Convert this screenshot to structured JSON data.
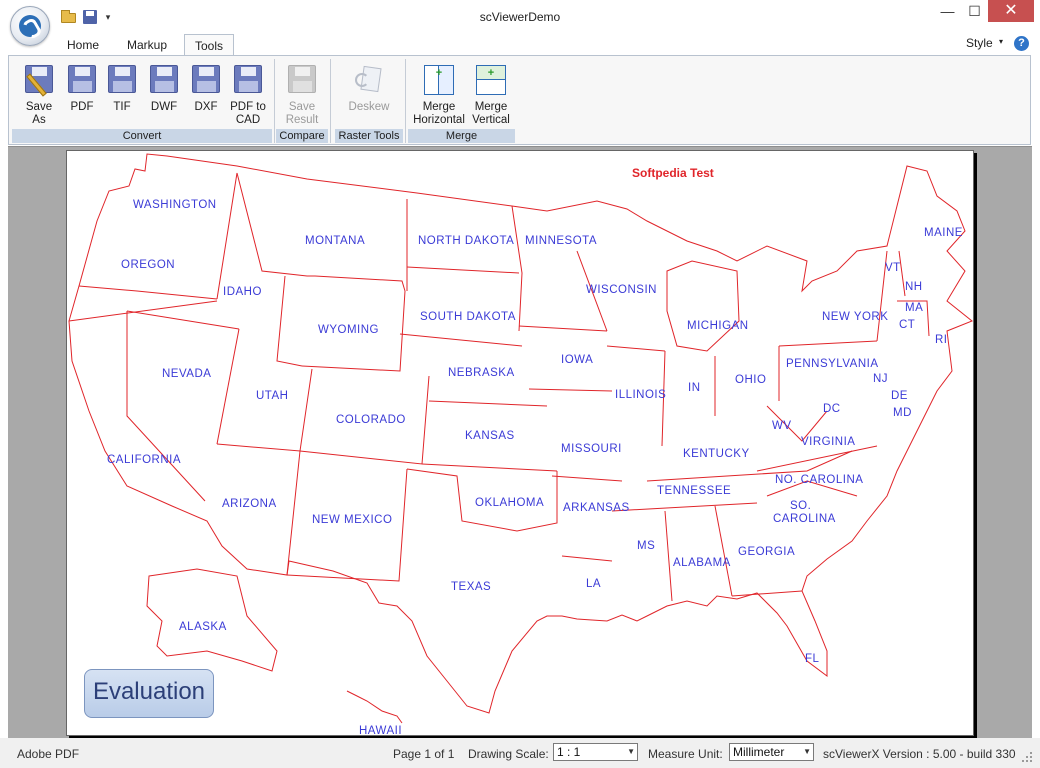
{
  "window": {
    "title": "scViewerDemo",
    "minimize_glyph": "—",
    "maximize_glyph": "☐",
    "close_glyph": "✕"
  },
  "quick_access": {
    "dropdown_glyph": "▾"
  },
  "tabs": {
    "home": "Home",
    "markup": "Markup",
    "tools": "Tools",
    "active": "Tools"
  },
  "style_menu": {
    "label": "Style",
    "arrow": "▾",
    "help": "?"
  },
  "ribbon": {
    "groups": {
      "convert": "Convert",
      "compare": "Compare",
      "raster_tools": "Raster Tools",
      "merge": "Merge"
    },
    "buttons": {
      "save_as": [
        "Save",
        "As"
      ],
      "pdf": "PDF",
      "tif": "TIF",
      "dwf": "DWF",
      "dxf": "DXF",
      "pdf_to_cad": [
        "PDF to",
        "CAD"
      ],
      "save_result": [
        "Save",
        "Result"
      ],
      "deskew": "Deskew",
      "merge_horizontal": [
        "Merge",
        "Horizontal"
      ],
      "merge_vertical": [
        "Merge",
        "Vertical"
      ]
    }
  },
  "document": {
    "watermark": "Softpedia Test",
    "evaluation_badge": "Evaluation",
    "line_color": "#e0252a",
    "label_color": "#3b3bd6",
    "states": {
      "washington": "WASHINGTON",
      "oregon": "OREGON",
      "california": "CALIFORNIA",
      "nevada": "NEVADA",
      "idaho": "IDAHO",
      "montana": "MONTANA",
      "wyoming": "WYOMING",
      "utah": "UTAH",
      "arizona": "ARIZONA",
      "colorado": "COLORADO",
      "new_mexico": "NEW  MEXICO",
      "north_dakota": "NORTH  DAKOTA",
      "south_dakota": "SOUTH  DAKOTA",
      "nebraska": "NEBRASKA",
      "kansas": "KANSAS",
      "oklahoma": "OKLAHOMA",
      "texas": "TEXAS",
      "minnesota": "MINNESOTA",
      "iowa": "IOWA",
      "missouri": "MISSOURI",
      "arkansas": "ARKANSAS",
      "la": "LA",
      "wisconsin": "WISCONSIN",
      "illinois": "ILLINOIS",
      "michigan": "MICHIGAN",
      "in": "IN",
      "ohio": "OHIO",
      "kentucky": "KENTUCKY",
      "tennessee": "TENNESSEE",
      "ms": "MS",
      "alabama": "ALABAMA",
      "georgia": "GEORGIA",
      "fl": "FL",
      "so_carolina_1": "SO.",
      "so_carolina_2": "CAROLINA",
      "no_carolina": "NO.  CAROLINA",
      "virginia": "VIRGINIA",
      "wv": "WV",
      "dc": "DC",
      "md": "MD",
      "de": "DE",
      "nj": "NJ",
      "pennsylvania": "PENNSYLVANIA",
      "new_york": "NEW  YORK",
      "ct": "CT",
      "ri": "RI",
      "ma": "MA",
      "vt": "VT",
      "nh": "NH",
      "maine": "MAINE",
      "alaska": "ALASKA",
      "hawaii": "HAWAII"
    }
  },
  "statusbar": {
    "file_type": "Adobe PDF",
    "page_info": "Page 1 of 1",
    "drawing_scale_label": "Drawing Scale:",
    "drawing_scale_value": "1 : 1",
    "measure_unit_label": "Measure Unit:",
    "measure_unit_value": "Millimeter",
    "version": "scViewerX Version : 5.00 - build 330"
  }
}
